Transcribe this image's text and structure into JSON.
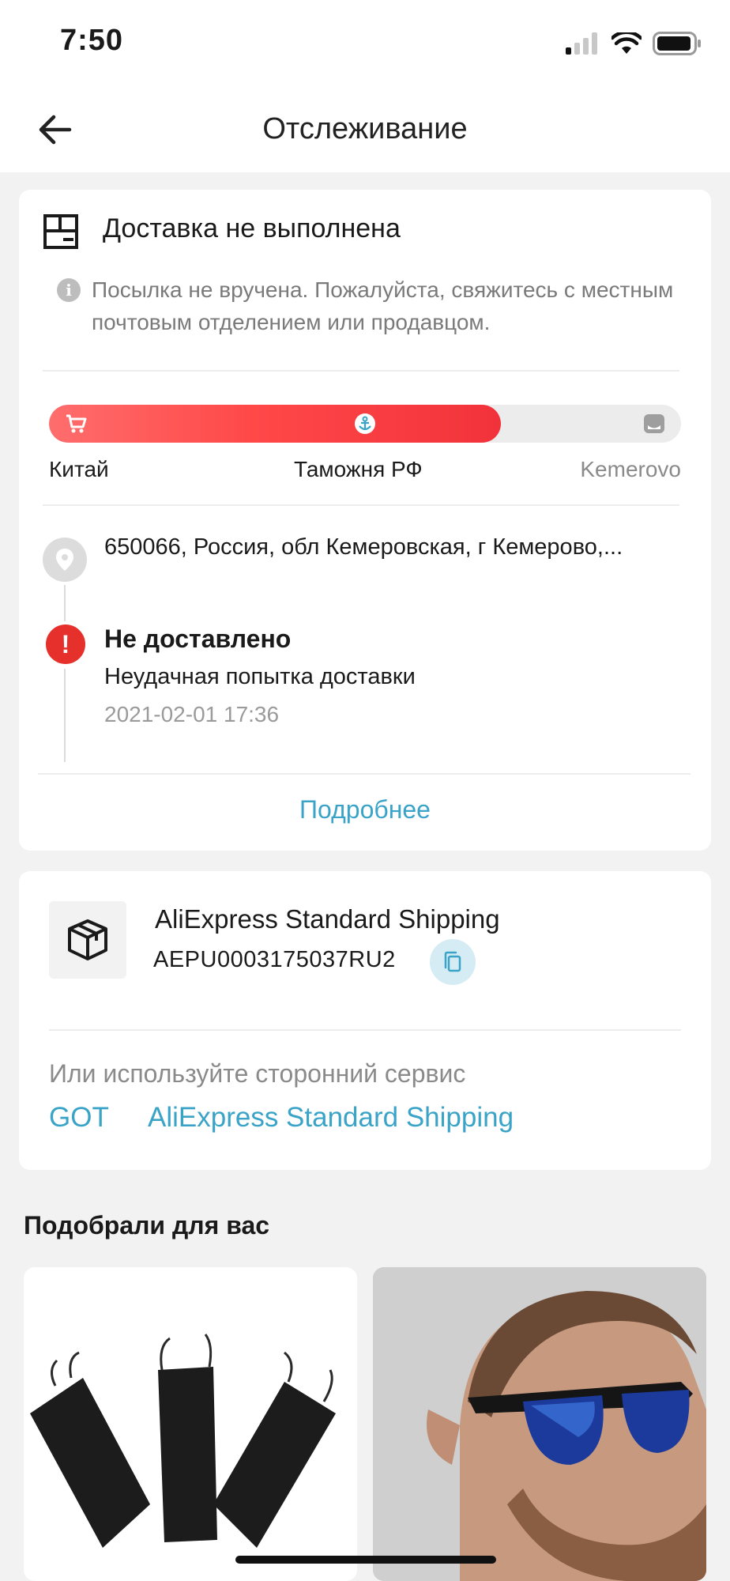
{
  "status_bar": {
    "time": "7:50"
  },
  "nav": {
    "title": "Отслеживание"
  },
  "delivery": {
    "status_title": "Доставка не выполнена",
    "info_text": "Посылка не вручена. Пожалуйста, свяжитесь с местным почтовым отделением или продавцом.",
    "progress_fraction": 0.715,
    "progress_labels": {
      "origin": "Китай",
      "customs": "Таможня РФ",
      "destination": "Kemerovo"
    },
    "address": "650066,  Россия, обл Кемеровская, г Кемерово,...",
    "event": {
      "title": "Не доставлено",
      "description": "Неудачная попытка доставки",
      "date": "2021-02-01 17:36"
    },
    "more_label": "Подробнее"
  },
  "shipping": {
    "service_name": "AliExpress Standard Shipping",
    "tracking_number": "AEPU0003175037RU2",
    "other_service_label": "Или используйте сторонний сервис",
    "links": [
      "GOT",
      "AliExpress Standard Shipping"
    ]
  },
  "recommendations": {
    "title": "Подобрали для вас"
  },
  "colors": {
    "accent_red": "#f2323b",
    "link_blue": "#3aa3c8",
    "error_red": "#e5302b"
  },
  "icons": [
    "back-arrow-icon",
    "delivery-box-icon",
    "info-icon",
    "cart-icon",
    "anchor-icon",
    "mailbox-icon",
    "location-pin-icon",
    "error-icon",
    "package-icon",
    "copy-icon"
  ]
}
